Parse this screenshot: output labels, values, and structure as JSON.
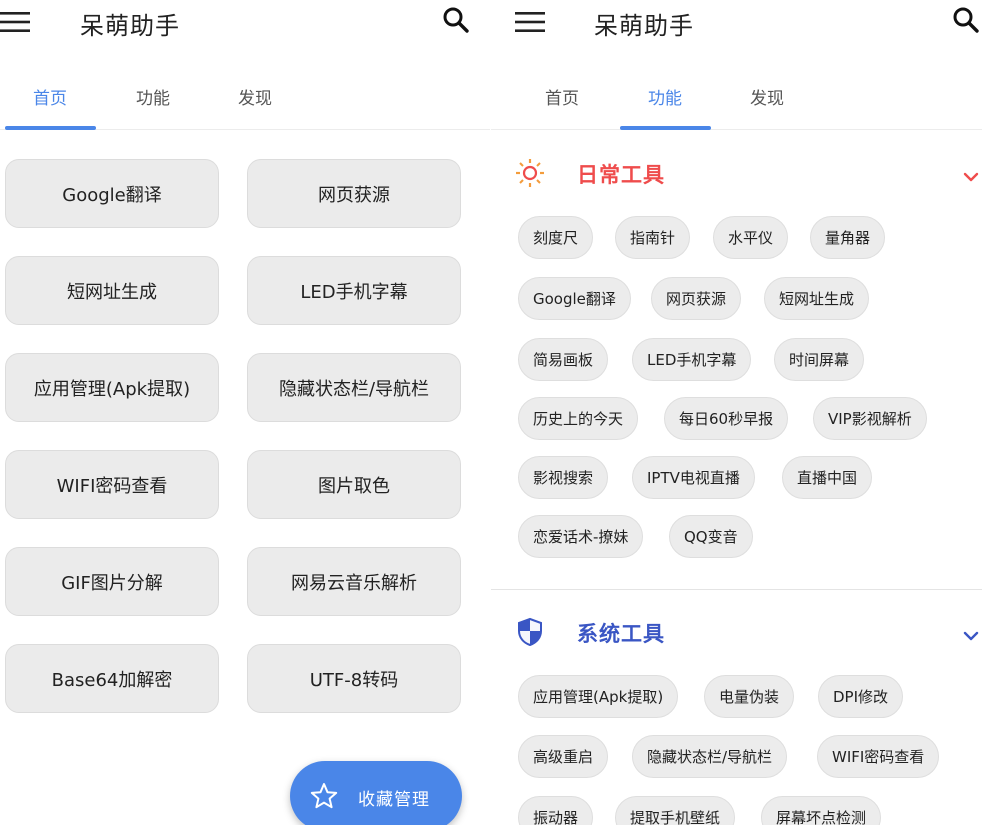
{
  "app": {
    "title": "呆萌助手"
  },
  "colors": {
    "accent": "#4a86e8",
    "daily_tools": "#ef4c4c",
    "system_tools": "#3a56c4"
  },
  "icons": {
    "menu": "hamburger-menu-icon",
    "search": "magnifier-icon",
    "fab": "star-outline-icon",
    "daily": "sun-icon",
    "system": "shield-icon",
    "expand": "chevron-down-icon"
  },
  "tabs": [
    {
      "label": "首页"
    },
    {
      "label": "功能"
    },
    {
      "label": "发现"
    }
  ],
  "left": {
    "active_tab": "首页",
    "grid": [
      {
        "label": "Google翻译"
      },
      {
        "label": "网页获源"
      },
      {
        "label": "短网址生成"
      },
      {
        "label": "LED手机字幕"
      },
      {
        "label": "应用管理(Apk提取)"
      },
      {
        "label": "隐藏状态栏/导航栏"
      },
      {
        "label": "WIFI密码查看"
      },
      {
        "label": "图片取色"
      },
      {
        "label": "GIF图片分解"
      },
      {
        "label": "网易云音乐解析"
      },
      {
        "label": "Base64加解密"
      },
      {
        "label": "UTF-8转码"
      }
    ],
    "fab": {
      "label": "收藏管理"
    }
  },
  "right": {
    "active_tab": "功能",
    "sections": [
      {
        "title": "日常工具",
        "chips": [
          {
            "label": "刻度尺"
          },
          {
            "label": "指南针"
          },
          {
            "label": "水平仪"
          },
          {
            "label": "量角器"
          },
          {
            "label": "Google翻译"
          },
          {
            "label": "网页获源"
          },
          {
            "label": "短网址生成"
          },
          {
            "label": "简易画板"
          },
          {
            "label": "LED手机字幕"
          },
          {
            "label": "时间屏幕"
          },
          {
            "label": "历史上的今天"
          },
          {
            "label": "每日60秒早报"
          },
          {
            "label": "VIP影视解析"
          },
          {
            "label": "影视搜索"
          },
          {
            "label": "IPTV电视直播"
          },
          {
            "label": "直播中国"
          },
          {
            "label": "恋爱话术-撩妹"
          },
          {
            "label": "QQ变音"
          }
        ]
      },
      {
        "title": "系统工具",
        "chips": [
          {
            "label": "应用管理(Apk提取)"
          },
          {
            "label": "电量伪装"
          },
          {
            "label": "DPI修改"
          },
          {
            "label": "高级重启"
          },
          {
            "label": "隐藏状态栏/导航栏"
          },
          {
            "label": "WIFI密码查看"
          },
          {
            "label": "振动器"
          },
          {
            "label": "提取手机壁纸"
          },
          {
            "label": "屏幕坏点检测"
          }
        ]
      }
    ]
  }
}
